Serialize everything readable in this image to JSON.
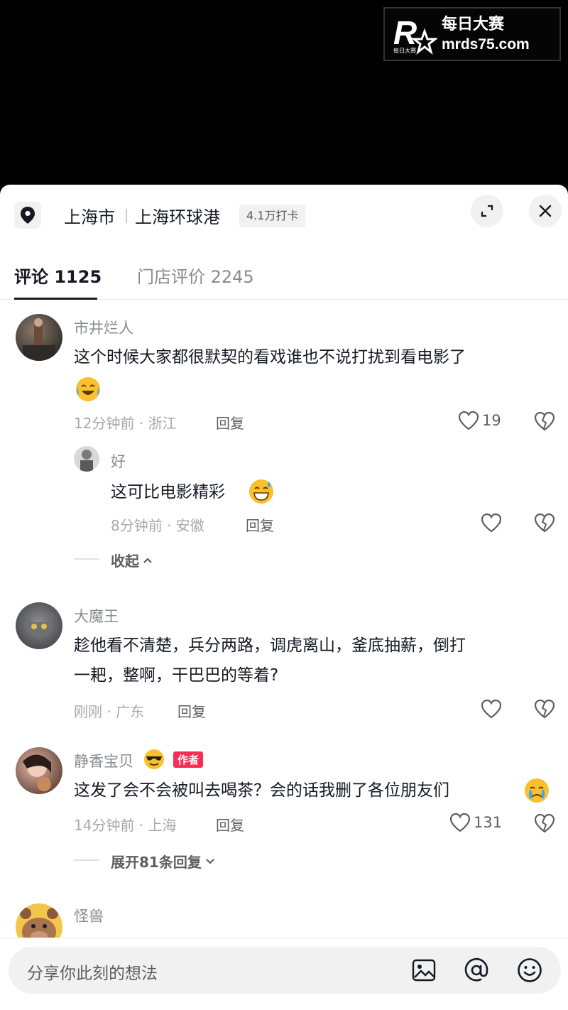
{
  "watermark": {
    "brand_cn": "每日大赛",
    "url": "mrds75.com",
    "logo_letter": "R",
    "logo_small_text": "每日大赛"
  },
  "location": {
    "city": "上海市",
    "place": "上海环球港",
    "checkins": "4.1万打卡",
    "pin_icon": "location-pin-icon"
  },
  "header_buttons": {
    "expand_icon": "expand-icon",
    "close_icon": "close-icon"
  },
  "tabs": [
    {
      "label": "评论 1125",
      "active": true
    },
    {
      "label": "门店评价 2245",
      "active": false
    }
  ],
  "comments": [
    {
      "username": "市井烂人",
      "text_line1": "这个时候大家都很默契的看戏谁也不说打扰到看电影了",
      "emoji": "laughing-crying-emoji",
      "meta": "12分钟前 · 浙江",
      "reply_label": "回复",
      "likes": "19",
      "reply": {
        "username": "好",
        "text": "这可比电影精彩",
        "emoji": "grin-sweat-emoji",
        "meta": "8分钟前 · 安徽",
        "reply_label": "回复"
      },
      "toggle": "收起"
    },
    {
      "username": "大魔王",
      "text_line1": "趁他看不清楚，兵分两路，调虎离山，釜底抽薪，倒打",
      "text_line2": "一耙，整啊，干巴巴的等着?",
      "meta": "刚刚 · 广东",
      "reply_label": "回复"
    },
    {
      "username": "静香宝贝",
      "username_emoji": "sunglasses-emoji",
      "badge": "作者",
      "text_line1": "这发了会不会被叫去喝茶？会的话我删了各位朋友们",
      "emoji": "crying-emoji",
      "meta": "14分钟前 · 上海",
      "reply_label": "回复",
      "likes": "131",
      "toggle": "展开81条回复"
    },
    {
      "username": "怪兽"
    }
  ],
  "input": {
    "placeholder": "分享你此刻的想法"
  },
  "colors": {
    "accent": "#fe2c55",
    "text": "#161823",
    "muted": "#8a8b91",
    "panel": "#f1f1f2"
  }
}
